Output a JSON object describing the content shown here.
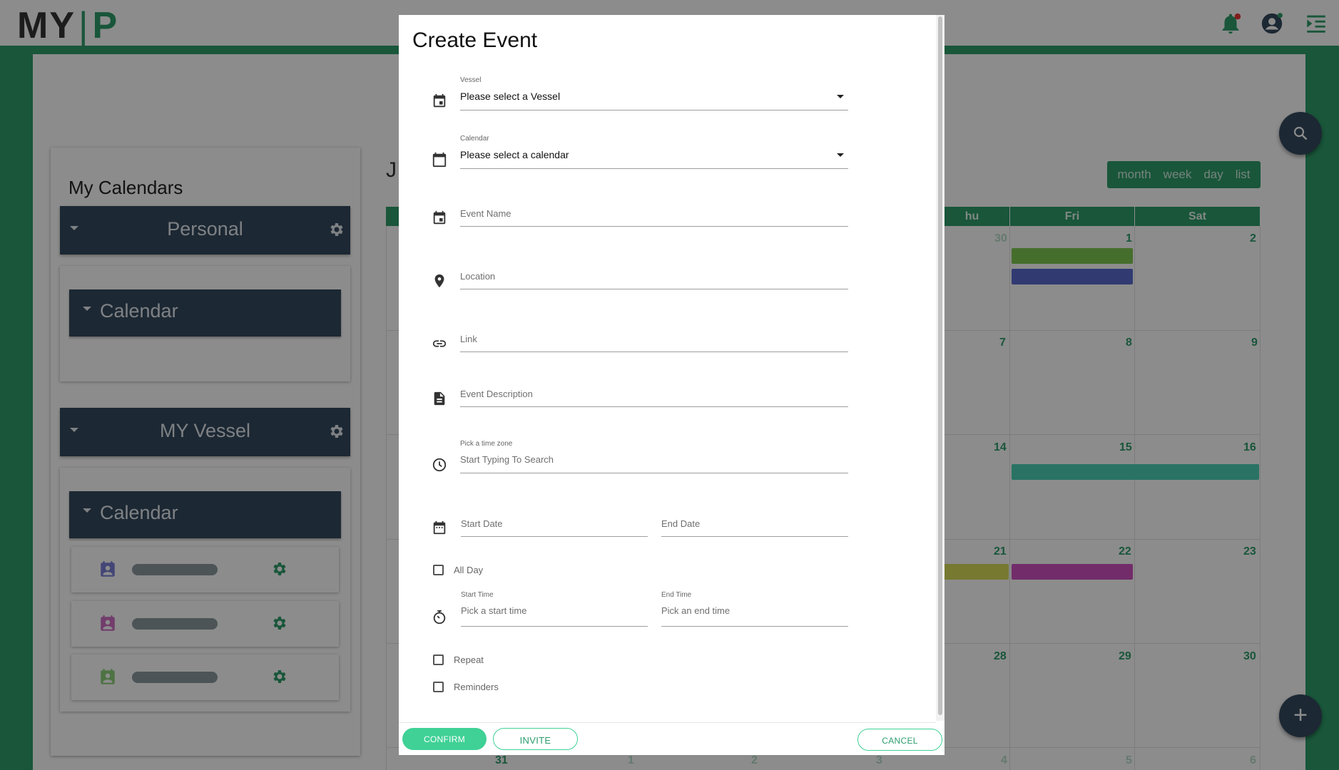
{
  "app": {
    "logo_left": "MY",
    "logo_separator": "|",
    "logo_right": "P"
  },
  "sidebar": {
    "title": "My Calendars",
    "groups": [
      {
        "label": "Personal",
        "sub_label": "Calendar"
      },
      {
        "label": "MY Vessel",
        "sub_label": "Calendar"
      }
    ],
    "calendar_item_colors": [
      "#7a80d8",
      "#cf6fc5",
      "#8fd17a"
    ]
  },
  "calendar": {
    "month_initial": "J",
    "views": [
      "month",
      "week",
      "day",
      "list"
    ],
    "weekday_headers": [
      "hu",
      "Fri",
      "Sat"
    ],
    "day_numbers": [
      [
        "30",
        "1",
        "2"
      ],
      [
        "7",
        "8",
        "9"
      ],
      [
        "14",
        "15",
        "16"
      ],
      [
        "21",
        "22",
        "23"
      ],
      [
        "28",
        "29",
        "30"
      ]
    ],
    "bottom_row_numbers": [
      "31",
      "1",
      "2",
      "3",
      "4",
      "5",
      "6"
    ],
    "event_colors": [
      "#7ec850",
      "#5a6ccf",
      "#4bd0b6",
      "#d9dc5a",
      "#d051c2"
    ]
  },
  "dialog": {
    "title": "Create Event",
    "vessel": {
      "label": "Vessel",
      "value": "Please select a Vessel"
    },
    "calendar": {
      "label": "Calendar",
      "value": "Please select a calendar"
    },
    "event_name": {
      "placeholder": "Event Name"
    },
    "location": {
      "placeholder": "Location"
    },
    "link": {
      "placeholder": "Link"
    },
    "description": {
      "placeholder": "Event Description"
    },
    "time_zone": {
      "label": "Pick a time zone",
      "placeholder": "Start Typing To Search"
    },
    "start_date": {
      "placeholder": "Start Date"
    },
    "end_date": {
      "placeholder": "End Date"
    },
    "all_day": "All Day",
    "start_time": {
      "label": "Start Time",
      "placeholder": "Pick a start time"
    },
    "end_time": {
      "label": "End Time",
      "placeholder": "Pick an end time"
    },
    "repeat": "Repeat",
    "reminders": "Reminders",
    "buttons": {
      "confirm": "CONFIRM",
      "invite": "INVITE",
      "cancel": "CANCEL"
    }
  },
  "colors": {
    "brand_green": "#2e9d6a",
    "header_dark": "#34495e",
    "button_green": "#3fd196"
  }
}
